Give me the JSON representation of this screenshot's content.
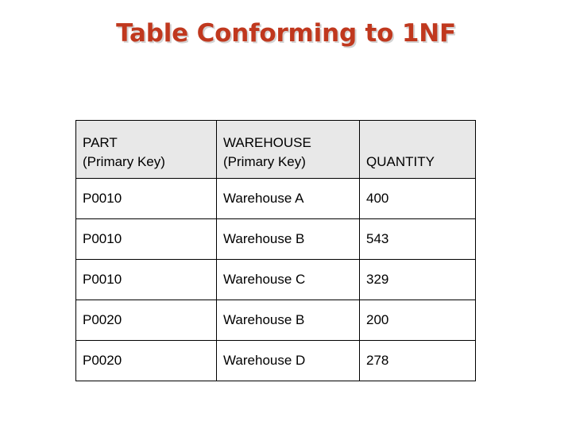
{
  "slide": {
    "title": "Table Conforming to 1NF",
    "title_color": "#c0381e",
    "background_color": "#ffffff"
  },
  "table": {
    "header_background": "#e8e8e8",
    "border_color": "#000000",
    "columns": [
      {
        "key": "part",
        "label": "PART\n(Primary Key)"
      },
      {
        "key": "warehouse",
        "label": "WAREHOUSE\n(Primary Key)"
      },
      {
        "key": "quantity",
        "label": "QUANTITY"
      }
    ],
    "rows": [
      {
        "part": "P0010",
        "warehouse": "Warehouse A",
        "quantity": "400"
      },
      {
        "part": "P0010",
        "warehouse": "Warehouse B",
        "quantity": "543"
      },
      {
        "part": "P0010",
        "warehouse": "Warehouse C",
        "quantity": "329"
      },
      {
        "part": "P0020",
        "warehouse": "Warehouse B",
        "quantity": "200"
      },
      {
        "part": "P0020",
        "warehouse": "Warehouse D",
        "quantity": "278"
      }
    ]
  }
}
